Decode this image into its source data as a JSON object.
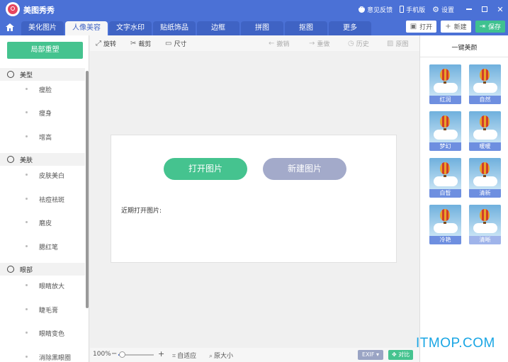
{
  "app": {
    "title": "美图秀秀"
  },
  "titlebar": {
    "feedback": "意见反馈",
    "mobile": "手机版",
    "settings": "设置"
  },
  "nav": {
    "tabs": [
      "美化图片",
      "人像美容",
      "文字水印",
      "贴纸饰品",
      "边框",
      "拼图",
      "抠图",
      "更多"
    ],
    "active_tab": 1,
    "open_label": "打开",
    "new_label": "新建",
    "save_label": "保存"
  },
  "sidebar": {
    "top_button": "局部重塑",
    "sections": [
      {
        "label": "美型",
        "items": [
          "瘦脸",
          "瘦身",
          "增高"
        ]
      },
      {
        "label": "美肤",
        "items": [
          "皮肤美白",
          "祛痘祛斑",
          "磨皮",
          "腮红笔"
        ]
      },
      {
        "label": "眼部",
        "items": [
          "眼睛放大",
          "睫毛膏",
          "眼睛变色",
          "消除黑眼圈"
        ]
      }
    ]
  },
  "toolbar": {
    "rotate": "旋转",
    "crop": "裁剪",
    "size": "尺寸",
    "undo": "撤销",
    "redo": "重做",
    "history": "历史",
    "original": "原图"
  },
  "canvas": {
    "open_button": "打开图片",
    "new_button": "新建图片",
    "recent_label": "近期打开图片:"
  },
  "statusbar": {
    "zoom": "100%",
    "zoom_fraction": 0.1,
    "fit": "自适应",
    "actual": "原大小",
    "exif": "EXIF",
    "compare": "对比"
  },
  "right_panel": {
    "title": "一键美颜",
    "presets": [
      "红润",
      "自然",
      "梦幻",
      "暖暖",
      "白皙",
      "清新",
      "冷艳",
      "清晰"
    ]
  },
  "watermark": "ITMOP.COM",
  "colors": {
    "brand": "#4b71d6",
    "accent_green": "#45c38f",
    "muted_button": "#a3aaca"
  }
}
